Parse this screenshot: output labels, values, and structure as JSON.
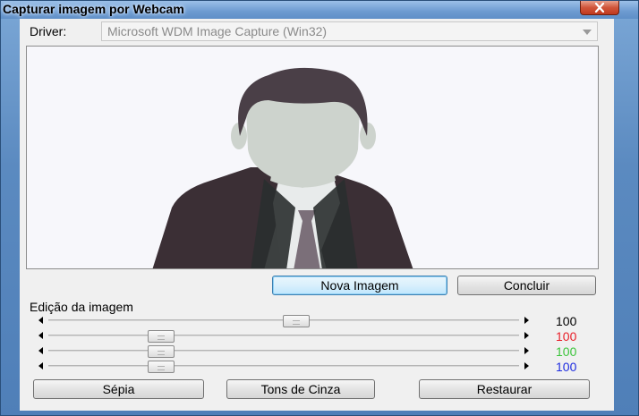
{
  "window": {
    "title": "Capturar imagem por Webcam"
  },
  "driver": {
    "label": "Driver:",
    "selected": "Microsoft WDM Image Capture (Win32)"
  },
  "buttons": {
    "new_image": "Nova Imagem",
    "finish": "Concluir",
    "sepia": "Sépia",
    "grayscale": "Tons de Cinza",
    "restore": "Restaurar"
  },
  "editing": {
    "label": "Edição da imagem",
    "sliders": [
      {
        "value": "100",
        "color": "#000000",
        "level": 0.55
      },
      {
        "value": "100",
        "color": "#e8202a",
        "level": 0.24
      },
      {
        "value": "100",
        "color": "#3cc43c",
        "level": 0.24
      },
      {
        "value": "100",
        "color": "#1f2de0",
        "level": 0.24
      }
    ]
  },
  "colors": {
    "titlebar": "#6c9ad0",
    "client_bg": "#f0f0f0",
    "close_button": "#c0391f"
  }
}
